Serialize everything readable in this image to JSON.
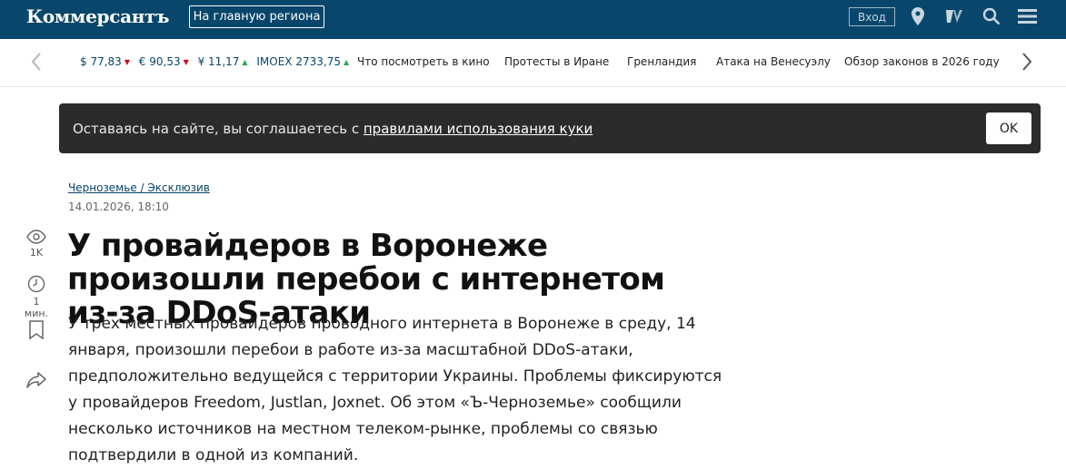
{
  "header": {
    "logo": "Коммерсантъ",
    "region_button": "На главную региона",
    "login": "Вход",
    "icons": [
      "location-icon",
      "tv-icon",
      "search-icon",
      "menu-icon"
    ]
  },
  "ticker": {
    "rates": [
      {
        "label": "$ 77,83",
        "trend": "down"
      },
      {
        "label": "€ 90,53",
        "trend": "down"
      },
      {
        "label": "¥ 11,17",
        "trend": "up"
      },
      {
        "label": "IMOEX 2733,75",
        "trend": "up"
      }
    ],
    "links": [
      "Что посмотреть в кино",
      "Протесты в Иране",
      "Гренландия",
      "Атака на Венесуэлу",
      "Обзор законов в 2026 году"
    ]
  },
  "cookie": {
    "text": "Оставаясь на сайте, вы соглашаетесь с ",
    "link": "правилами использования куки",
    "ok": "OK"
  },
  "article": {
    "rubric": "Черноземье / Эксклюзив",
    "datetime": "14.01.2026, 18:10",
    "title": "У провайдеров в Воронеже произошли перебои с интернетом из-за DDoS-атаки",
    "lead": "У трех местных провайдеров проводного интернета в Воронеже в среду, 14 января, произошли перебои в работе из-за масштабной DDoS-атаки, предположительно ведущейся с территории Украины. Проблемы фиксируются у провайдеров Freedom, Justlan, Joxnet. Об этом «Ъ-Черноземье» сообщили несколько источников на местном телеком-рынке, проблемы со связью подтвердили в одной из компаний."
  },
  "sidebar": {
    "views": "1K",
    "read_time": "1 мин."
  },
  "colors": {
    "header_bg": "#08466b",
    "cookie_bg": "#2b2b2b",
    "trend_down": "#d0021b",
    "trend_up": "#2aa845"
  }
}
